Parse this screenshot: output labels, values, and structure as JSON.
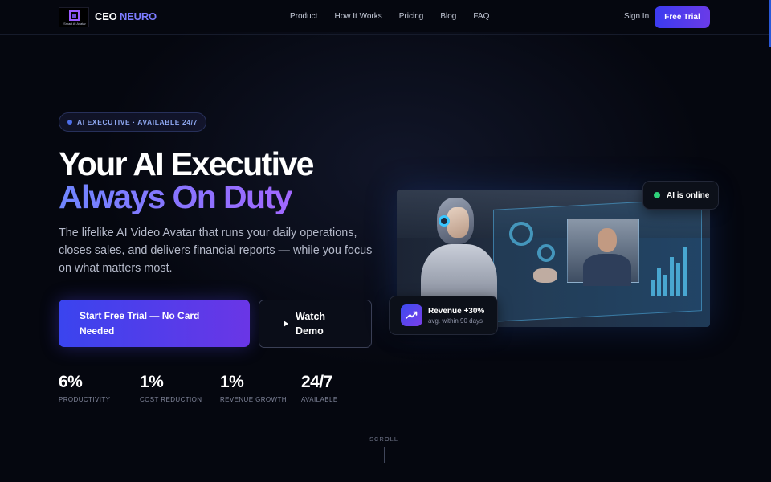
{
  "nav": {
    "logo_tagline": "Smart AI Avatar",
    "brand_part1": "CEO",
    "brand_part2": "NEURO",
    "links": [
      "Product",
      "How It Works",
      "Pricing",
      "Blog",
      "FAQ"
    ],
    "sign_in": "Sign In",
    "free_trial": "Free Trial"
  },
  "hero": {
    "badge": "AI EXECUTIVE · AVAILABLE 24/7",
    "title_line1": "Your AI Executive",
    "title_line2": "Always On Duty",
    "subtitle": "The lifelike AI Video Avatar that runs your daily operations, closes sales, and delivers financial reports — while you focus on what matters most.",
    "cta_primary": "Start Free Trial — No Card Needed",
    "cta_secondary": "Watch Demo"
  },
  "stats": [
    {
      "value": "6%",
      "label": "PRODUCTIVITY"
    },
    {
      "value": "1%",
      "label": "COST REDUCTION"
    },
    {
      "value": "1%",
      "label": "REVENUE GROWTH"
    },
    {
      "value": "24/7",
      "label": "AVAILABLE"
    }
  ],
  "media": {
    "status": "AI is online",
    "revenue_title": "Revenue +30%",
    "revenue_sub": "avg. within 90 days",
    "icons": {
      "status": "online-dot-icon",
      "revenue": "trending-up-icon",
      "play": "play-icon"
    }
  },
  "scroll_label": "SCROLL",
  "colors": {
    "accent": "#4b45f0",
    "accent2": "#7a3ce8",
    "online": "#2fd27a",
    "background": "#05070f"
  }
}
